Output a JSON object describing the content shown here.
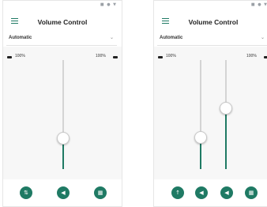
{
  "colors": {
    "accent": "#1f7a64",
    "track": "#d4d4d4"
  },
  "screens": [
    {
      "title": "Volume Control",
      "dropdown": {
        "value": "Automatic"
      },
      "labels": {
        "left_pct": "100%",
        "right_pct": "100%"
      },
      "sliders": [
        {
          "level": 0.28
        }
      ],
      "buttons": [
        {
          "icon": "equalizer-icon"
        },
        {
          "icon": "speaker-icon"
        },
        {
          "icon": "settings-panel-icon"
        }
      ]
    },
    {
      "title": "Volume Control",
      "dropdown": {
        "value": "Automatic"
      },
      "labels": {
        "left_pct": "100%",
        "right_pct": "100%"
      },
      "sliders": [
        {
          "level": 0.29
        },
        {
          "level": 0.56
        }
      ],
      "buttons": [
        {
          "icon": "single-slider-icon"
        },
        {
          "icon": "speaker-icon"
        },
        {
          "icon": "speaker-icon"
        },
        {
          "icon": "settings-panel-icon"
        }
      ]
    }
  ]
}
